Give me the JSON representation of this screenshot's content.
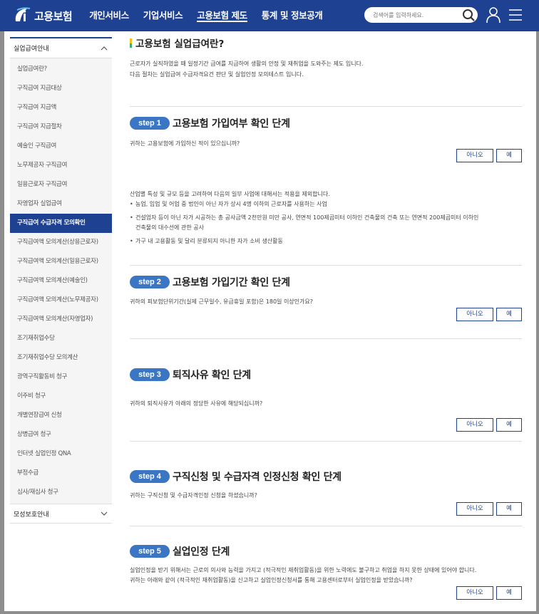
{
  "header": {
    "logo_text": "고용보험",
    "nav": [
      "개인서비스",
      "기업서비스",
      "고용보험 제도",
      "통계 및 정보공개"
    ],
    "active_nav": 2,
    "search_placeholder": "검색어를 입력하세요."
  },
  "colors": {
    "brand": "#1e4191",
    "badge": "#3a76c4"
  },
  "sidebar": {
    "group1": "실업급여안내",
    "items": [
      "실업급여란?",
      "구직급여 지급대상",
      "구직급여 지급액",
      "구직급여 지급절차",
      "예술인 구직급여",
      "노무제공자 구직급여",
      "일용근로자 구직급여",
      "자영업자 실업급여",
      "구직급여 수급자격 모의확인",
      "구직급여액 모의계산(상용근로자)",
      "구직급여액 모의계산(일용근로자)",
      "구직급여액 모의계산(예술인)",
      "구직급여액 모의계산(노무제공자)",
      "구직급여액 모의계산(자영업자)",
      "조기재취업수당",
      "조기재취업수당 모의계산",
      "광역구직활동비 청구",
      "이주비 청구",
      "개별연장급여 신청",
      "상병급여 청구",
      "인터넷 실업인정 QNA",
      "부정수급",
      "심사/재심사 청구"
    ],
    "active_index": 8,
    "group2": "모성보호안내"
  },
  "content": {
    "title": "고용보험 실업급여란?",
    "intro1": "근로자가 실직하였을 때 일정기간 급여를 지급하여 생활의 안정 및 재취업을 도와주는 제도 입니다.",
    "intro2": "다음 절차는 실업급여 수급자격요건 판단 및 실업인정 모의테스트 입니다.",
    "no_label": "아니오",
    "yes_label": "예",
    "steps": [
      {
        "badge": "step 1",
        "title": "고용보험 가입여부 확인 단계",
        "question": "귀하는 고용보험에 가입하신 적이 있으십니까?"
      },
      {
        "badge": "step 2",
        "title": "고용보험 가입기간 확인 단계",
        "question": "귀하의 피보험단위기간(실제 근무일수, 유급휴일 포함)은 180일 이상인가요?"
      },
      {
        "badge": "step 3",
        "title": "퇴직사유 확인 단계",
        "question": "귀하의 퇴직사유가 아래의 정당한 사유에 해당되십니까?"
      },
      {
        "badge": "step 4",
        "title": "구직신청 및 수급자격 인정신청 확인 단계",
        "question": "귀하는 구직신청 및 수급자격인정 신청을 하셨습니까?"
      },
      {
        "badge": "step 5",
        "title": "실업인정 단계",
        "question": "실업인정을 받기 위해서는 근로의 의사와 능력을 가지고 (적극적인 재취업활동)을 위한 노력에도 불구하고 취업을 하지 못한 상태에 있어야 합니다.",
        "question2": "귀하는 아래와 같이 (적극적인 재취업활동)을 신고하고 실업인정신청서를 통해 고용센터로부터 실업인정을 받았습니까?"
      }
    ],
    "notes": {
      "lead": "산업별 특성 및 규모 등을 고려하여 다음의 일부 사업에 대해서는 적용을 제외합니다.",
      "b1": "농업, 임업 및 어업 중 법인이 아닌 자가 상시 4명 이하의 근로자를 사용하는 사업",
      "b2a": "건설업자 등이 아닌 자가 시공하는 총 공사금액 2천만원 미만 공사, 연면적 100제곱미터 이하인 건축물의 건축 또는 연면적 200제곱미터 이하인",
      "b2b": "건축물의 대수선에 관한 공사",
      "b3": "가구 내 고용활동 및 달리 분류되지 아니한 자가 소비 생산활동"
    }
  }
}
